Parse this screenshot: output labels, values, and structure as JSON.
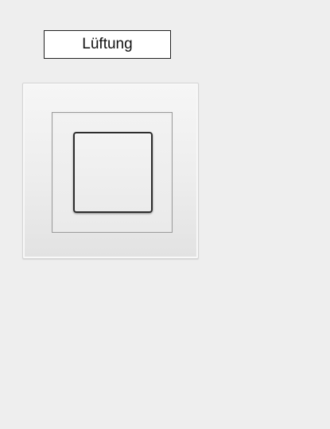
{
  "title": {
    "label": "Lüftung"
  },
  "switch": {
    "icon": "light-switch-icon",
    "frame_color": "#efefef",
    "rocker_color": "#ededed",
    "state": "off"
  },
  "colors": {
    "background": "#eeeeee",
    "title_border": "#222222"
  }
}
